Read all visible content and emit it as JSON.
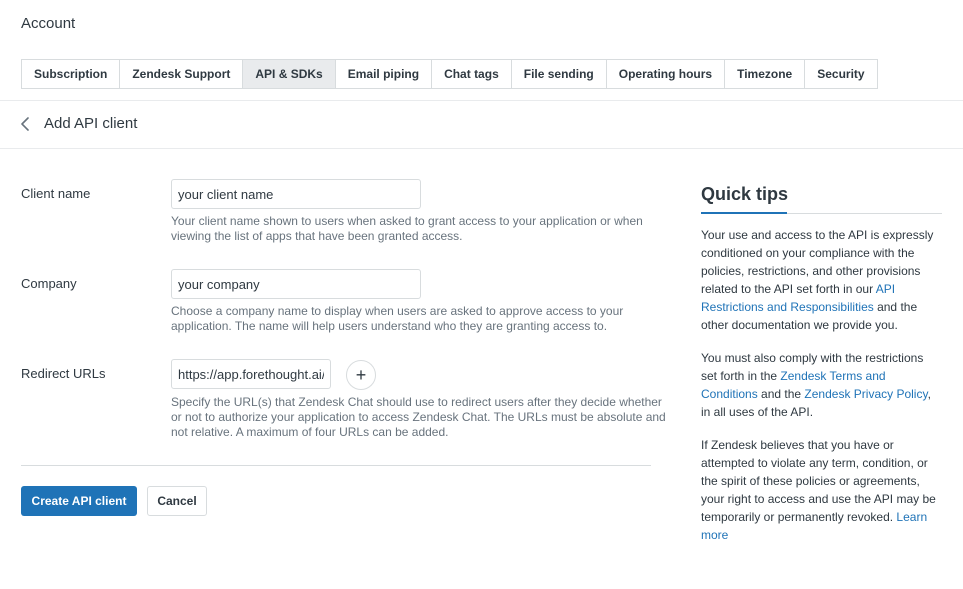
{
  "account": {
    "title": "Account"
  },
  "tabs": [
    {
      "label": "Subscription"
    },
    {
      "label": "Zendesk Support"
    },
    {
      "label": "API & SDKs"
    },
    {
      "label": "Email piping"
    },
    {
      "label": "Chat tags"
    },
    {
      "label": "File sending"
    },
    {
      "label": "Operating hours"
    },
    {
      "label": "Timezone"
    },
    {
      "label": "Security"
    }
  ],
  "active_tab": "API & SDKs",
  "header": {
    "title": "Add API client",
    "back_icon": "chevron-left-icon"
  },
  "form": {
    "client_name": {
      "label": "Client name",
      "value": "your client name",
      "help": "Your client name shown to users when asked to grant access to your application or when viewing the list of apps that have been granted access."
    },
    "company": {
      "label": "Company",
      "value": "your company",
      "help": "Choose a company name to display when users are asked to approve access to your application. The name will help users understand who they are granting access to."
    },
    "redirect_urls": {
      "label": "Redirect URLs",
      "value": "https://app.forethought.ai/",
      "add_label": "+",
      "help": "Specify the URL(s) that Zendesk Chat should use to redirect users after they decide whether or not to authorize your application to access Zendesk Chat. The URLs must be absolute and not relative. A maximum of four URLs can be added."
    },
    "create_label": "Create API client",
    "cancel_label": "Cancel"
  },
  "tips": {
    "title": "Quick tips",
    "p1_text": "Your use and access to the API is expressly conditioned on your compliance with the policies, restrictions, and other provisions related to the API set forth in our ",
    "p1_link": "API Restrictions and Responsibilities",
    "p1_end": " and the other documentation we provide you.",
    "p2_text": "You must also comply with the restrictions set forth in the ",
    "p2_link1": "Zendesk Terms and Conditions",
    "p2_mid": " and the ",
    "p2_link2": "Zendesk Privacy Policy",
    "p2_end": ", in all uses of the API.",
    "p3_text": "If Zendesk believes that you have or attempted to violate any term, condition, or the spirit of these policies or agreements, your right to access and use the API may be temporarily or permanently revoked. ",
    "p3_link": "Learn more"
  },
  "colors": {
    "accent": "#1f73b7",
    "text": "#2f3941",
    "muted": "#68737d",
    "border": "#d8dcde",
    "active_tab_bg": "#e9ebed"
  }
}
